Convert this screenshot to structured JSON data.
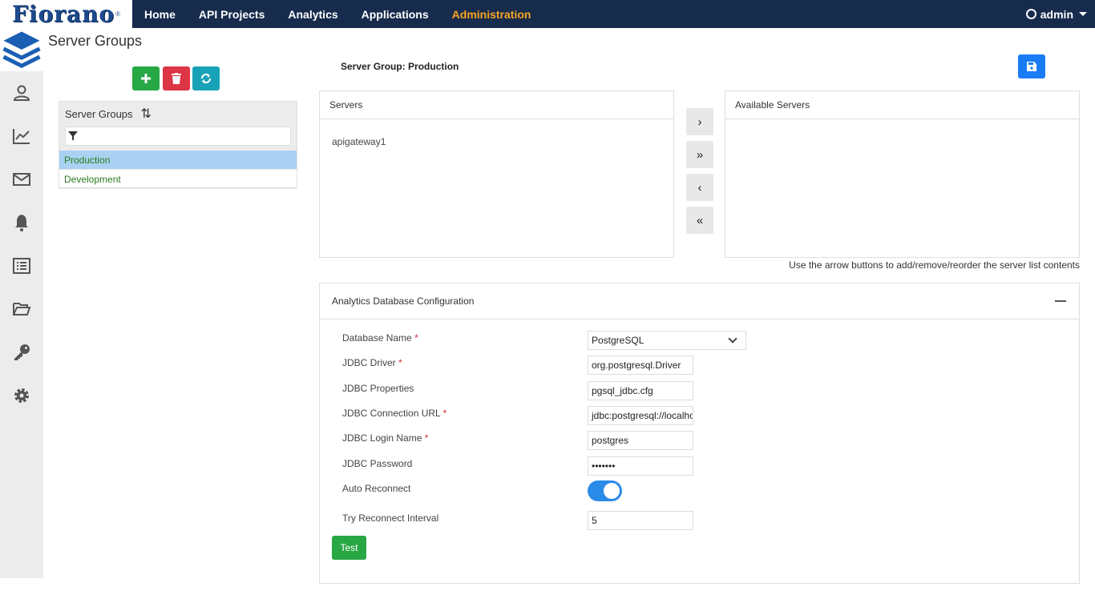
{
  "brand": {
    "logo_text": "Fiorano",
    "registered": "®"
  },
  "nav": {
    "items": [
      "Home",
      "API Projects",
      "Analytics",
      "Applications",
      "Administration"
    ],
    "active": "Administration"
  },
  "user": {
    "name": "admin"
  },
  "page": {
    "title": "Server Groups"
  },
  "list": {
    "header": "Server Groups",
    "items": [
      "Production",
      "Development"
    ],
    "selected": "Production"
  },
  "group": {
    "title": "Server Group: Production"
  },
  "servers": {
    "header": "Servers",
    "items": [
      "apigateway1"
    ]
  },
  "available": {
    "header": "Available Servers",
    "items": []
  },
  "arrows": {
    "move_right": "›",
    "move_all_right": "»",
    "move_left": "‹",
    "move_all_left": "«"
  },
  "hint": "Use the arrow buttons to add/remove/reorder the server list contents",
  "config": {
    "header": "Analytics Database Configuration",
    "fields": {
      "db_name": {
        "label": "Database Name",
        "value": "PostgreSQL",
        "required": "*"
      },
      "jdbc_driver": {
        "label": "JDBC Driver",
        "value": "org.postgresql.Driver",
        "required": "*"
      },
      "jdbc_props": {
        "label": "JDBC Properties",
        "value": "pgsql_jdbc.cfg"
      },
      "jdbc_url": {
        "label": "JDBC Connection URL",
        "value": "jdbc:postgresql://localhost",
        "required": "*"
      },
      "jdbc_login": {
        "label": "JDBC Login Name",
        "value": "postgres",
        "required": "*"
      },
      "jdbc_password": {
        "label": "JDBC Password",
        "value": "•••••••"
      },
      "auto_reconnect": {
        "label": "Auto Reconnect",
        "value": "on"
      },
      "reconnect_interval": {
        "label": "Try Reconnect Interval",
        "value": "5"
      }
    },
    "test_label": "Test"
  },
  "colors": {
    "nav_bg": "#172b4d",
    "active_nav": "#f5a623",
    "primary": "#1a7cf5",
    "success": "#28a745",
    "danger": "#dc3545",
    "info": "#17a2b8",
    "selected_row": "#aad1f1"
  }
}
